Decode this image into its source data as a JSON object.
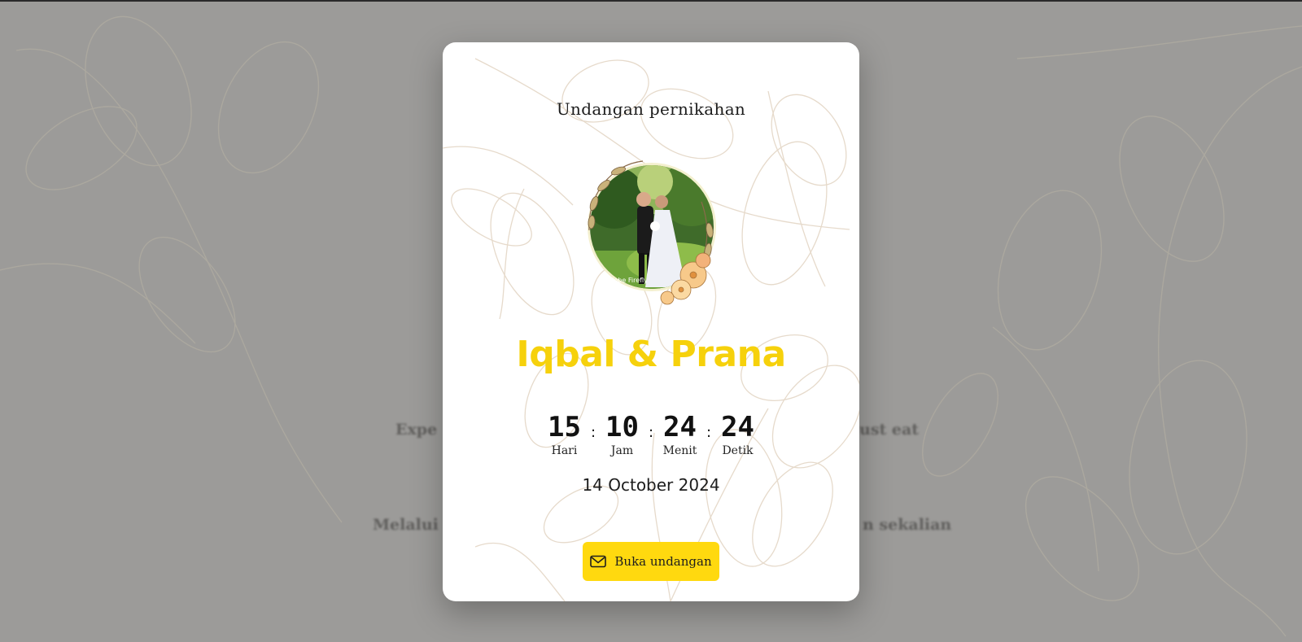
{
  "background": {
    "text_line_1_left": "Expe",
    "text_line_1_right": "ust eat",
    "text_line_2_left": "Melalui u",
    "text_line_2_right": "n sekalian",
    "overlay_color": "#9c9b99"
  },
  "modal": {
    "title": "Undangan pernikahan",
    "couple_names": "Iqbal & Prana",
    "photo_watermark": "Adobe Firefly",
    "countdown": {
      "days": {
        "value": "15",
        "label": "Hari"
      },
      "hours": {
        "value": "10",
        "label": "Jam"
      },
      "minutes": {
        "value": "24",
        "label": "Menit"
      },
      "seconds": {
        "value": "24",
        "label": "Detik"
      },
      "separator": ":"
    },
    "event_date": "14 October 2024",
    "open_button": {
      "label": "Buka undangan",
      "icon": "mail-icon"
    }
  },
  "colors": {
    "accent_yellow": "#f6d10c",
    "button_yellow": "#ffd90f",
    "floral_line": "#e4d7c4"
  }
}
